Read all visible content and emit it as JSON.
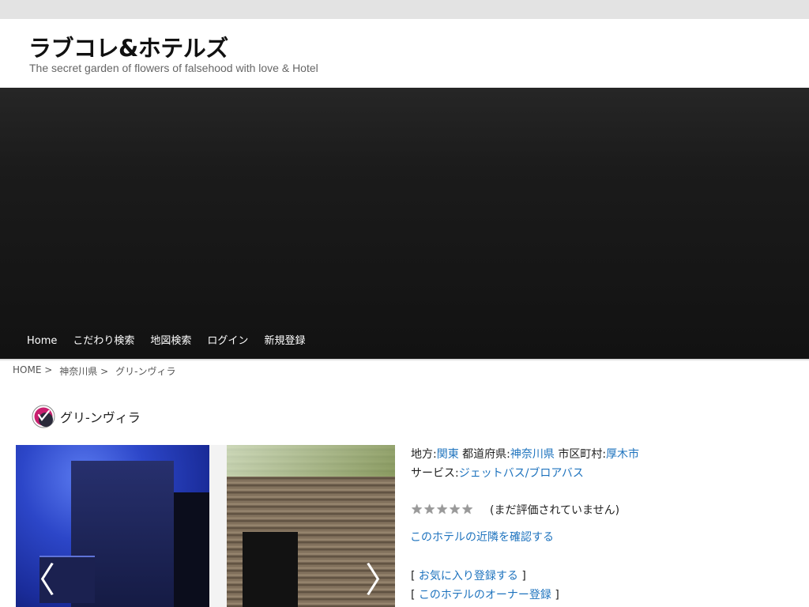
{
  "site": {
    "title": "ラブコレ&ホテルズ",
    "tagline": "The secret garden of flowers of falsehood with love & Hotel"
  },
  "nav": [
    {
      "label": "Home"
    },
    {
      "label": "こだわり検索"
    },
    {
      "label": "地図検索"
    },
    {
      "label": "ログイン"
    },
    {
      "label": "新規登録"
    }
  ],
  "breadcrumb": [
    "HOME >",
    "神奈川県 >",
    "グリ-ンヴィラ"
  ],
  "post": {
    "title": "グリ-ンヴィラ",
    "icon": "brand-logo-icon"
  },
  "gallery": {
    "prev_icon": "chevron-left-icon",
    "next_icon": "chevron-right-icon",
    "prev_glyph": "〈",
    "next_glyph": "〉"
  },
  "info": {
    "region_label": "地方:",
    "region_value": "関東",
    "pref_label": "都道府県:",
    "pref_value": "神奈川県",
    "city_label": "市区町村:",
    "city_value": "厚木市",
    "service_label": "サービス:",
    "service_value": "ジェットバス/ブロアバス",
    "rating_text": "(まだ評価されていません)",
    "rating_stars": 0,
    "rating_max": 5,
    "neighborhood_link": "このホテルの近隣を確認する",
    "bracket_open": "[",
    "bracket_close": "]",
    "favorite_link": "お気に入り登録する",
    "owner_link": "このホテルのオーナー登録"
  },
  "colors": {
    "link": "#1e73be",
    "hero": "#161616"
  }
}
